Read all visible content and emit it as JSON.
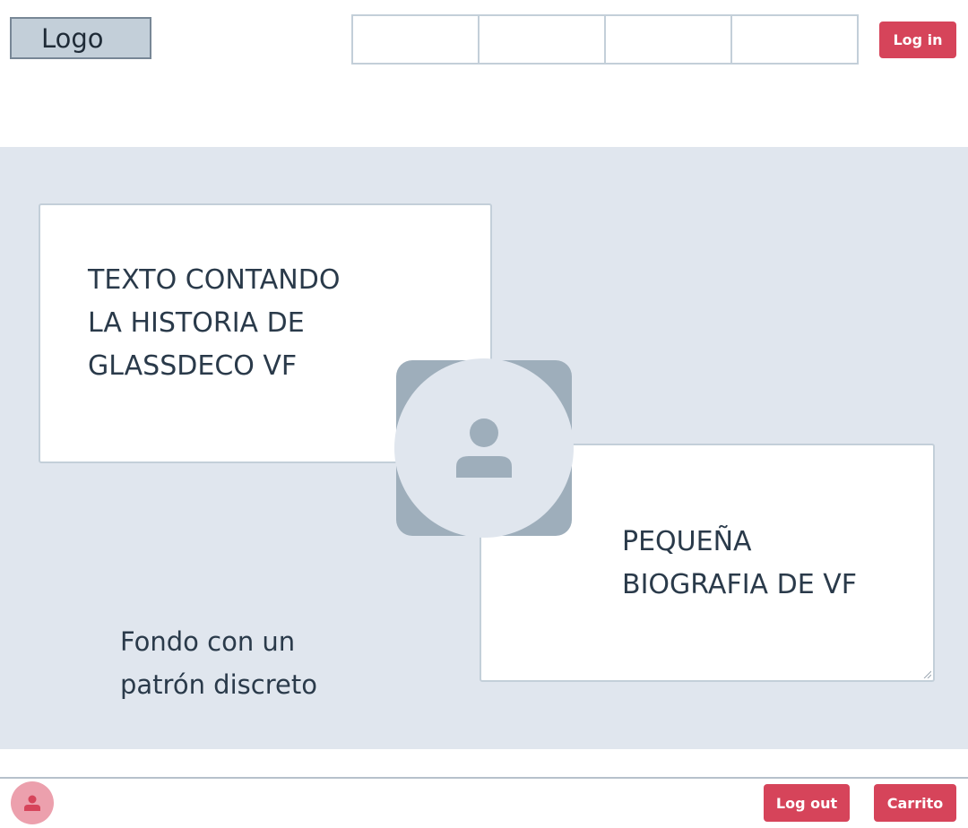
{
  "header": {
    "logo_text": "Logo",
    "nav_items": [
      "",
      "",
      "",
      ""
    ],
    "login_label": "Log in"
  },
  "hero": {
    "history_text": "TEXTO CONTANDO\nLA HISTORIA DE\nGLASSDECO VF",
    "bio_text": "PEQUEÑA\nBIOGRAFIA DE VF",
    "background_note": "Fondo con un\npatrón discreto",
    "profile_icon": "user-icon"
  },
  "footer": {
    "user_icon": "user-icon",
    "logout_label": "Log out",
    "cart_label": "Carrito"
  },
  "colors": {
    "accent": "#d6445a",
    "hero_background": "#e0e6ee",
    "placeholder_gray": "#9eaebb",
    "footer_avatar": "#eca0ad"
  }
}
